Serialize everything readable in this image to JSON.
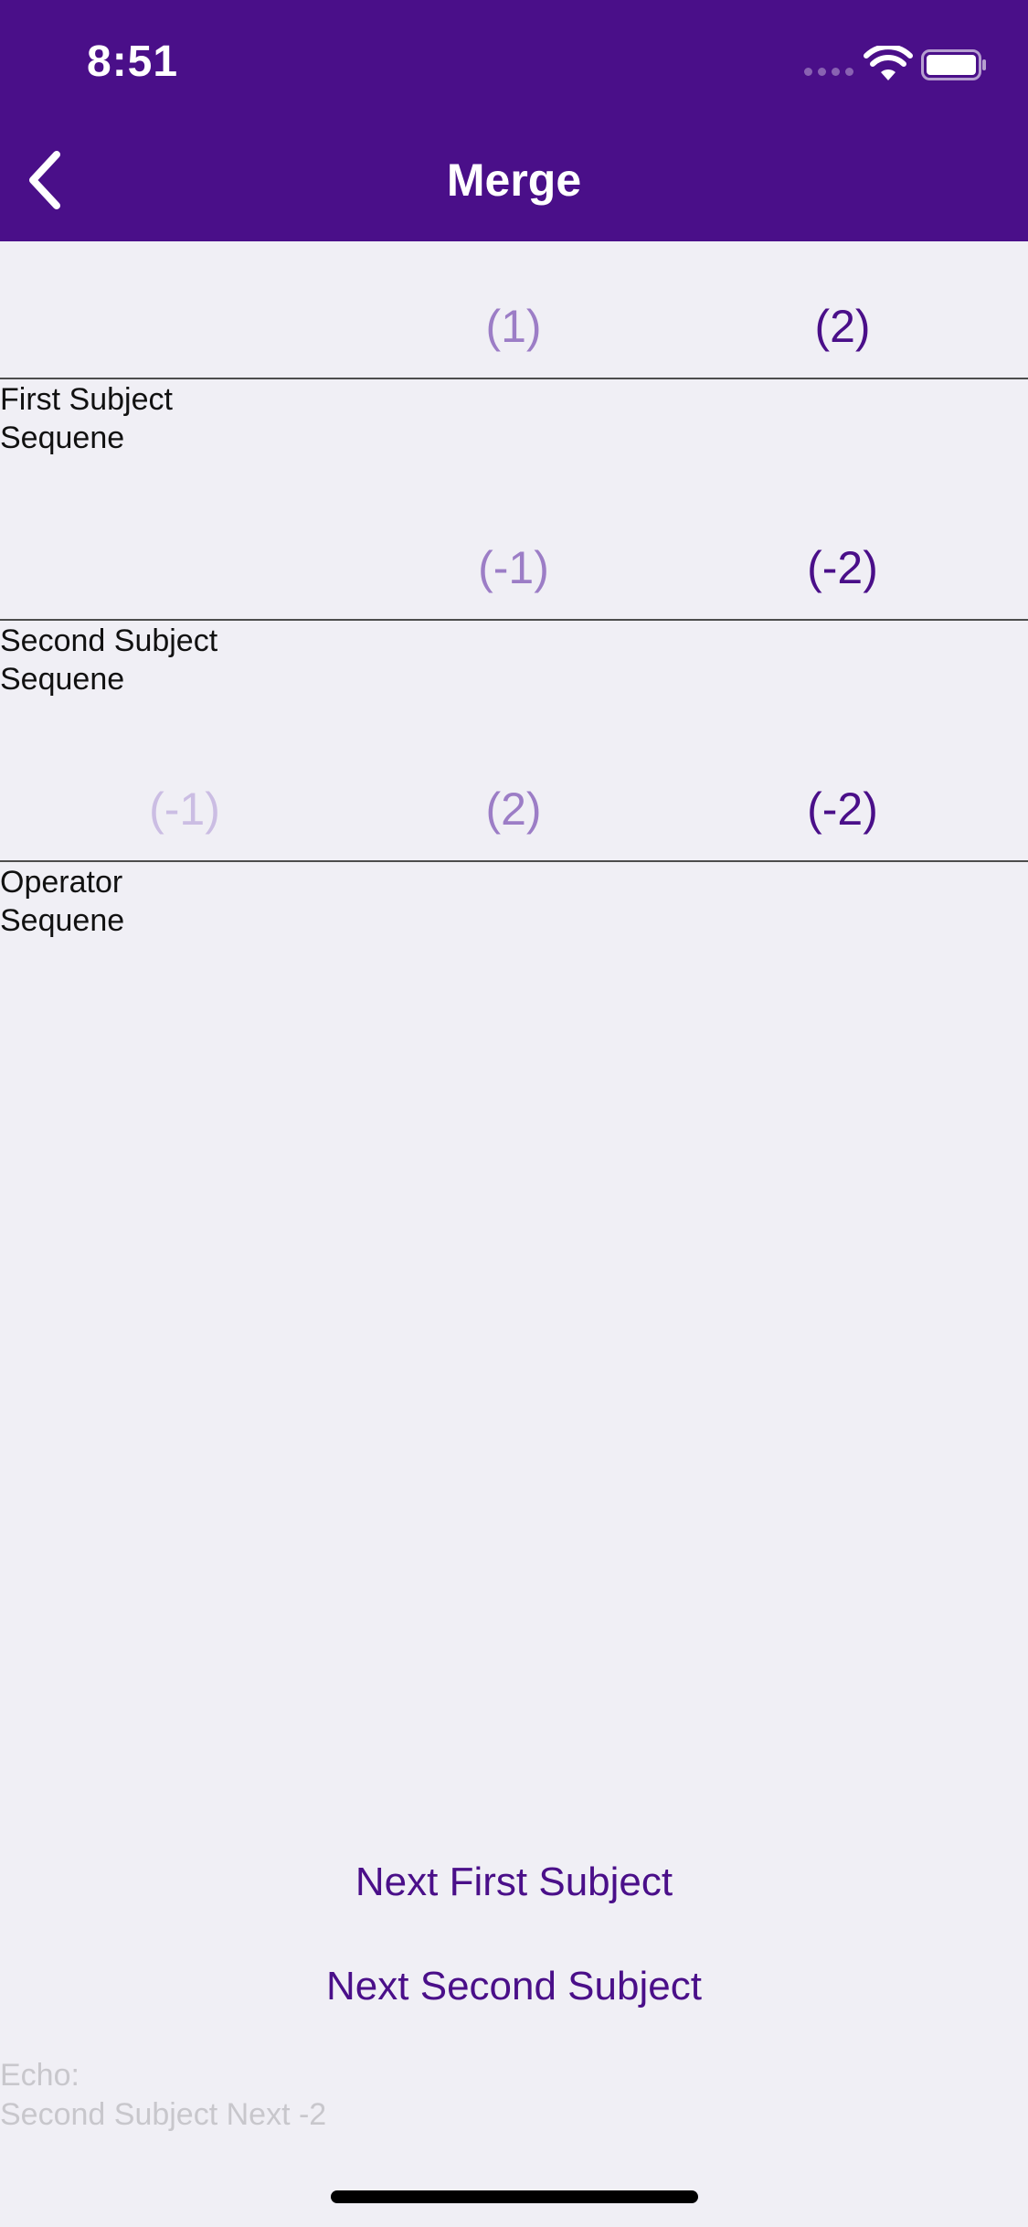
{
  "status_bar": {
    "time": "8:51"
  },
  "nav": {
    "title": "Merge",
    "back_icon": "chevron-left-icon"
  },
  "colors": {
    "brand": "#4a0f89",
    "marble_strong": "#4a0f89",
    "marble_medium": "#9c7dc6",
    "marble_faint": "#cbbde3",
    "echo_text": "#c8c7cc"
  },
  "first_subject": {
    "label_line1": "First Subject",
    "label_line2": "Sequene",
    "marbles": [
      "(1)",
      "(2)"
    ]
  },
  "second_subject": {
    "label_line1": "Second Subject",
    "label_line2": "Sequene",
    "marbles": [
      "(-1)",
      "(-2)"
    ]
  },
  "operator": {
    "label_line1": "Operator",
    "label_line2": "Sequene",
    "marbles": [
      "(-1)",
      "(2)",
      "(-2)"
    ]
  },
  "buttons": {
    "next_first": "Next First Subject",
    "next_second": "Next Second Subject"
  },
  "echo": {
    "label": "Echo:",
    "value": "Second Subject Next -2"
  }
}
